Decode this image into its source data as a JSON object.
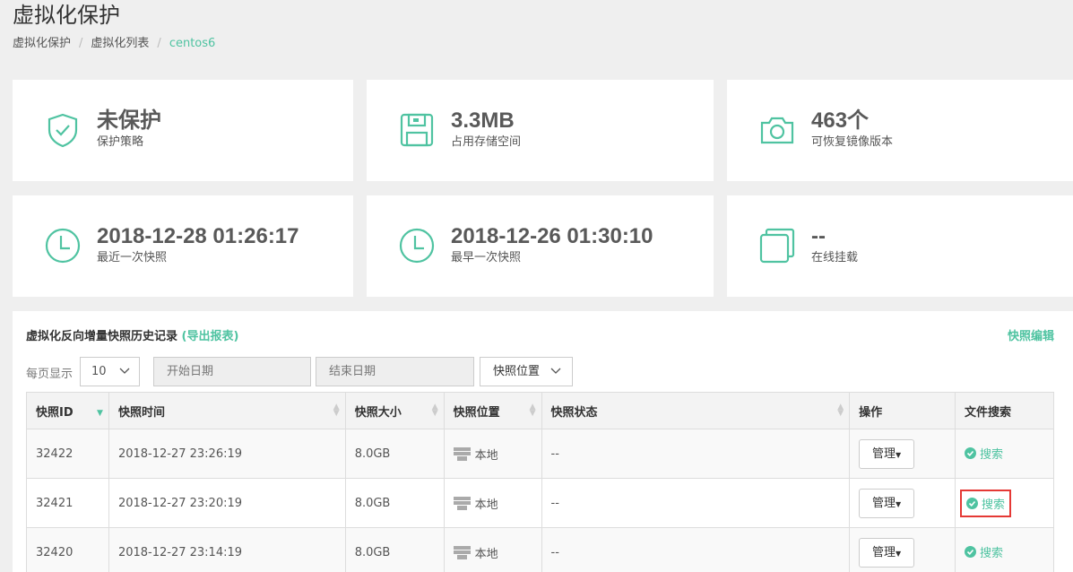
{
  "page": {
    "title": "虚拟化保护"
  },
  "breadcrumb": [
    "虚拟化保护",
    "虚拟化列表",
    "centos6"
  ],
  "cards": [
    {
      "value": "未保护",
      "label": "保护策略",
      "icon": "shield-check-icon"
    },
    {
      "value": "3.3MB",
      "label": "占用存储空间",
      "icon": "floppy-disk-icon"
    },
    {
      "value": "463个",
      "label": "可恢复镜像版本",
      "icon": "camera-icon"
    },
    {
      "value": "2018-12-28 01:26:17",
      "label": "最近一次快照",
      "icon": "clock-icon"
    },
    {
      "value": "2018-12-26 01:30:10",
      "label": "最早一次快照",
      "icon": "clock-icon"
    },
    {
      "value": "--",
      "label": "在线挂载",
      "icon": "copy-icon"
    }
  ],
  "panel": {
    "title": "虚拟化反向增量快照历史记录",
    "export_link": "(导出报表)",
    "edit_link": "快照编辑",
    "perpage_label": "每页显示",
    "perpage_value": "10",
    "start_placeholder": "开始日期",
    "end_placeholder": "结束日期",
    "location_filter": "快照位置"
  },
  "table": {
    "headers": [
      "快照ID",
      "快照时间",
      "快照大小",
      "快照位置",
      "快照状态",
      "操作",
      "文件搜索"
    ],
    "rows": [
      {
        "id": "32422",
        "time": "2018-12-27 23:26:19",
        "size": "8.0GB",
        "location": "本地",
        "status": "--",
        "action": "管理",
        "search": "搜索"
      },
      {
        "id": "32421",
        "time": "2018-12-27 23:20:19",
        "size": "8.0GB",
        "location": "本地",
        "status": "--",
        "action": "管理",
        "search": "搜索"
      },
      {
        "id": "32420",
        "time": "2018-12-27 23:14:19",
        "size": "8.0GB",
        "location": "本地",
        "status": "--",
        "action": "管理",
        "search": "搜索"
      }
    ]
  },
  "colors": {
    "accent": "#4fc3a1",
    "highlight": "#e53935"
  }
}
